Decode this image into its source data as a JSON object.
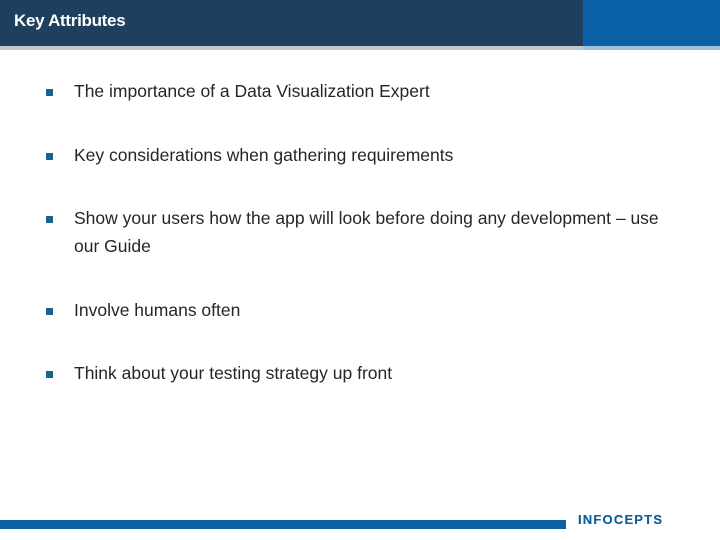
{
  "slide": {
    "header": {
      "title": "Key Attributes",
      "navy_color": "#1f3f5e",
      "accent_color": "#0a61a6"
    },
    "bullets": [
      {
        "marker": "square-bullet",
        "text": "The importance of a Data Visualization Expert"
      },
      {
        "marker": "square-bullet",
        "text": "Key considerations when gathering requirements"
      },
      {
        "marker": "square-bullet",
        "text": "Show your users how the app will look before doing any development – use our Guide"
      },
      {
        "marker": "square-bullet",
        "text": "Involve humans often"
      },
      {
        "marker": "square-bullet",
        "text": "Think about your testing strategy up front"
      }
    ],
    "footer": {
      "logo_text": "InfoCepts",
      "bar_color": "#0b61a5",
      "logo_color": "#16639c"
    }
  }
}
